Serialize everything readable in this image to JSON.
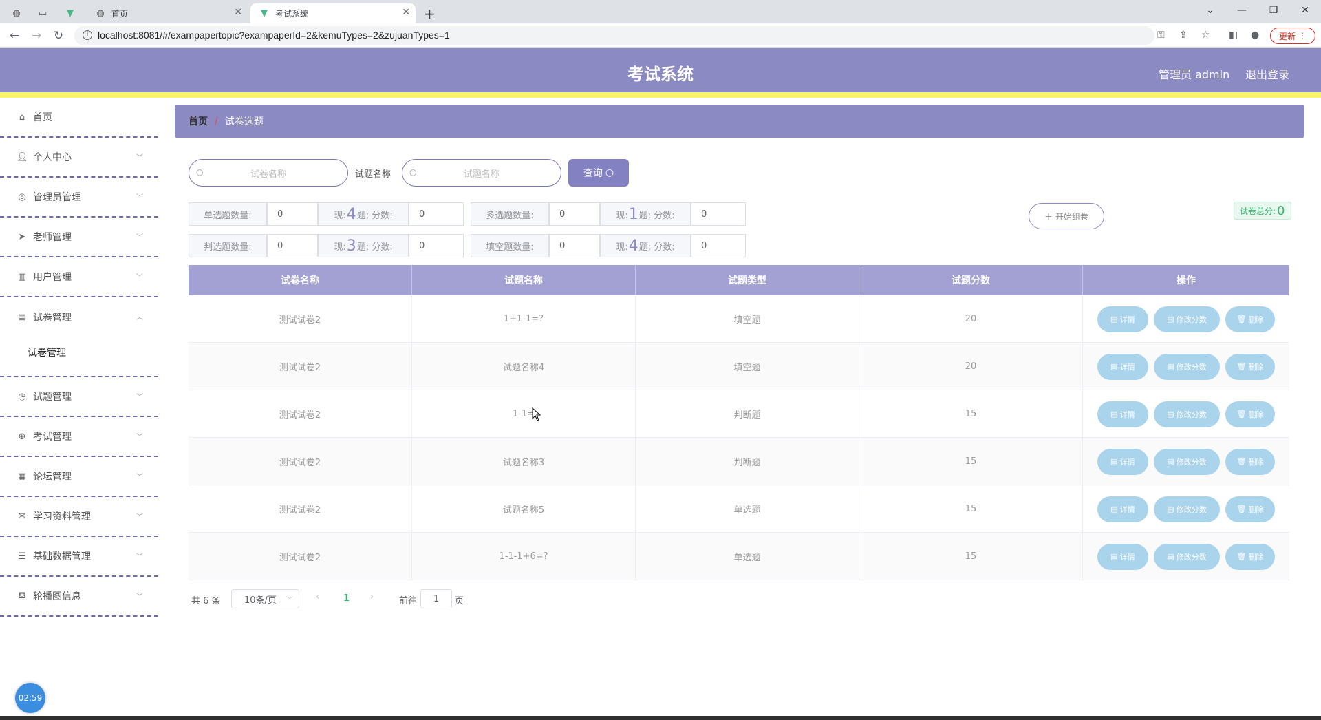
{
  "browser": {
    "tabs": [
      {
        "title": "",
        "icon": "globe-icon"
      },
      {
        "title": "",
        "icon": "blank-page-icon"
      },
      {
        "title": "",
        "icon": "vue-icon"
      },
      {
        "title": "首页",
        "icon": "globe-icon"
      },
      {
        "title": "考试系统",
        "icon": "vue-icon"
      }
    ],
    "url": "localhost:8081/#/exampapertopic?exampaperId=2&kemuTypes=2&zujuanTypes=1",
    "update_label": "更新"
  },
  "header": {
    "title": "考试系统",
    "user_label": "管理员 admin",
    "logout_label": "退出登录"
  },
  "sidebar": {
    "items": [
      {
        "label": "首页",
        "icon": "home-icon"
      },
      {
        "label": "个人中心",
        "icon": "user-icon"
      },
      {
        "label": "管理员管理",
        "icon": "compass-icon"
      },
      {
        "label": "老师管理",
        "icon": "send-icon"
      },
      {
        "label": "用户管理",
        "icon": "chart-icon"
      },
      {
        "label": "试卷管理",
        "icon": "clipboard-icon"
      },
      {
        "label": "试题管理",
        "icon": "clock-icon"
      },
      {
        "label": "考试管理",
        "icon": "target-icon"
      },
      {
        "label": "论坛管理",
        "icon": "grid-icon"
      },
      {
        "label": "学习资料管理",
        "icon": "mail-icon"
      },
      {
        "label": "基础数据管理",
        "icon": "sliders-icon"
      },
      {
        "label": "轮播图信息",
        "icon": "brush-icon"
      }
    ],
    "active_sub": "试卷管理",
    "clock": "02:59"
  },
  "breadcrumb": {
    "home": "首页",
    "separator": "/",
    "current": "试卷选题"
  },
  "search": {
    "paper_placeholder": "试卷名称",
    "topic_label": "试题名称",
    "topic_placeholder": "试题名称",
    "query_label": "查询"
  },
  "counts": {
    "single_label": "单选题数量:",
    "single_value": "0",
    "single_now_pre": "现:",
    "single_now": "4",
    "single_now_post": "题; 分数:",
    "single_score": "0",
    "multi_label": "多选题数量:",
    "multi_value": "0",
    "multi_now_pre": "现:",
    "multi_now": "1",
    "multi_now_post": "题; 分数:",
    "multi_score": "0",
    "judge_label": "判选题数量:",
    "judge_value": "0",
    "judge_now_pre": "现:",
    "judge_now": "3",
    "judge_now_post": "题; 分数:",
    "judge_score": "0",
    "fill_label": "填空题数量:",
    "fill_value": "0",
    "fill_now_pre": "现:",
    "fill_now": "4",
    "fill_now_post": "题; 分数:",
    "fill_score": "0",
    "start_label": "开始组卷",
    "total_label": "试卷总分:",
    "total_value": "0"
  },
  "table": {
    "headers": [
      "试卷名称",
      "试题名称",
      "试题类型",
      "试题分数",
      "操作"
    ],
    "rows": [
      {
        "paper": "测试试卷2",
        "topic": "1+1-1=?",
        "type": "填空题",
        "score": "20"
      },
      {
        "paper": "测试试卷2",
        "topic": "试题名称4",
        "type": "填空题",
        "score": "20"
      },
      {
        "paper": "测试试卷2",
        "topic": "1-1=",
        "type": "判断题",
        "score": "15"
      },
      {
        "paper": "测试试卷2",
        "topic": "试题名称3",
        "type": "判断题",
        "score": "15"
      },
      {
        "paper": "测试试卷2",
        "topic": "试题名称5",
        "type": "单选题",
        "score": "15"
      },
      {
        "paper": "测试试卷2",
        "topic": "1-1-1+6=?",
        "type": "单选题",
        "score": "15"
      }
    ],
    "actions": {
      "detail": "详情",
      "edit_score": "修改分数",
      "delete": "删除"
    }
  },
  "pagination": {
    "total": "共 6 条",
    "page_size": "10条/页",
    "current_page": "1",
    "goto_label": "前往",
    "goto_value": "1",
    "page_suffix": "页"
  }
}
